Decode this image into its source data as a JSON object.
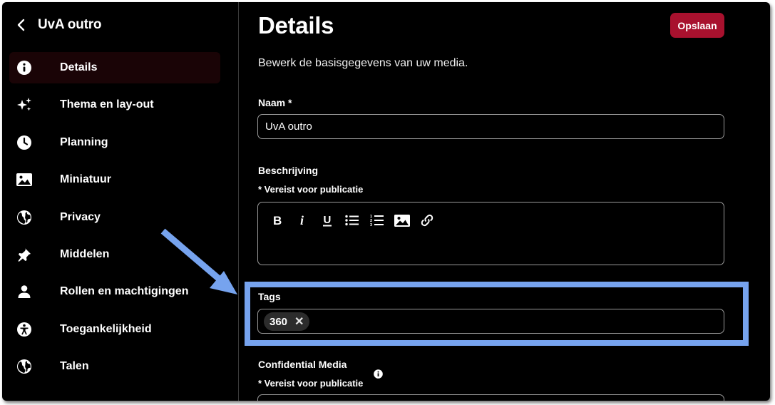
{
  "sidebar": {
    "back_title": "UvA outro",
    "items": [
      {
        "label": "Details",
        "icon": "info-icon",
        "active": true
      },
      {
        "label": "Thema en lay-out",
        "icon": "sparkles-icon"
      },
      {
        "label": "Planning",
        "icon": "clock-icon"
      },
      {
        "label": "Miniatuur",
        "icon": "image-icon"
      },
      {
        "label": "Privacy",
        "icon": "globe-icon"
      },
      {
        "label": "Middelen",
        "icon": "pin-icon"
      },
      {
        "label": "Rollen en machtigingen",
        "icon": "person-icon"
      },
      {
        "label": "Toegankelijkheid",
        "icon": "accessibility-icon"
      },
      {
        "label": "Talen",
        "icon": "globe-icon"
      }
    ]
  },
  "main": {
    "title": "Details",
    "save_label": "Opslaan",
    "subtitle": "Bewerk de basisgegevens van uw media.",
    "name": {
      "label": "Naam *",
      "value": "UvA outro"
    },
    "description": {
      "label": "Beschrijving",
      "required_note": "* Vereist voor publicatie",
      "toolbar": [
        "bold",
        "italic",
        "underline",
        "bulleted-list",
        "numbered-list",
        "insert-image",
        "insert-link"
      ]
    },
    "tags": {
      "label": "Tags",
      "chips": [
        "360"
      ]
    },
    "confidential": {
      "label": "Confidential Media",
      "required_note": "* Vereist voor publicatie"
    }
  },
  "colors": {
    "background": "#000000",
    "accent": "#a8112e",
    "active_nav": "#1a0406",
    "highlight": "#76a3ee"
  }
}
